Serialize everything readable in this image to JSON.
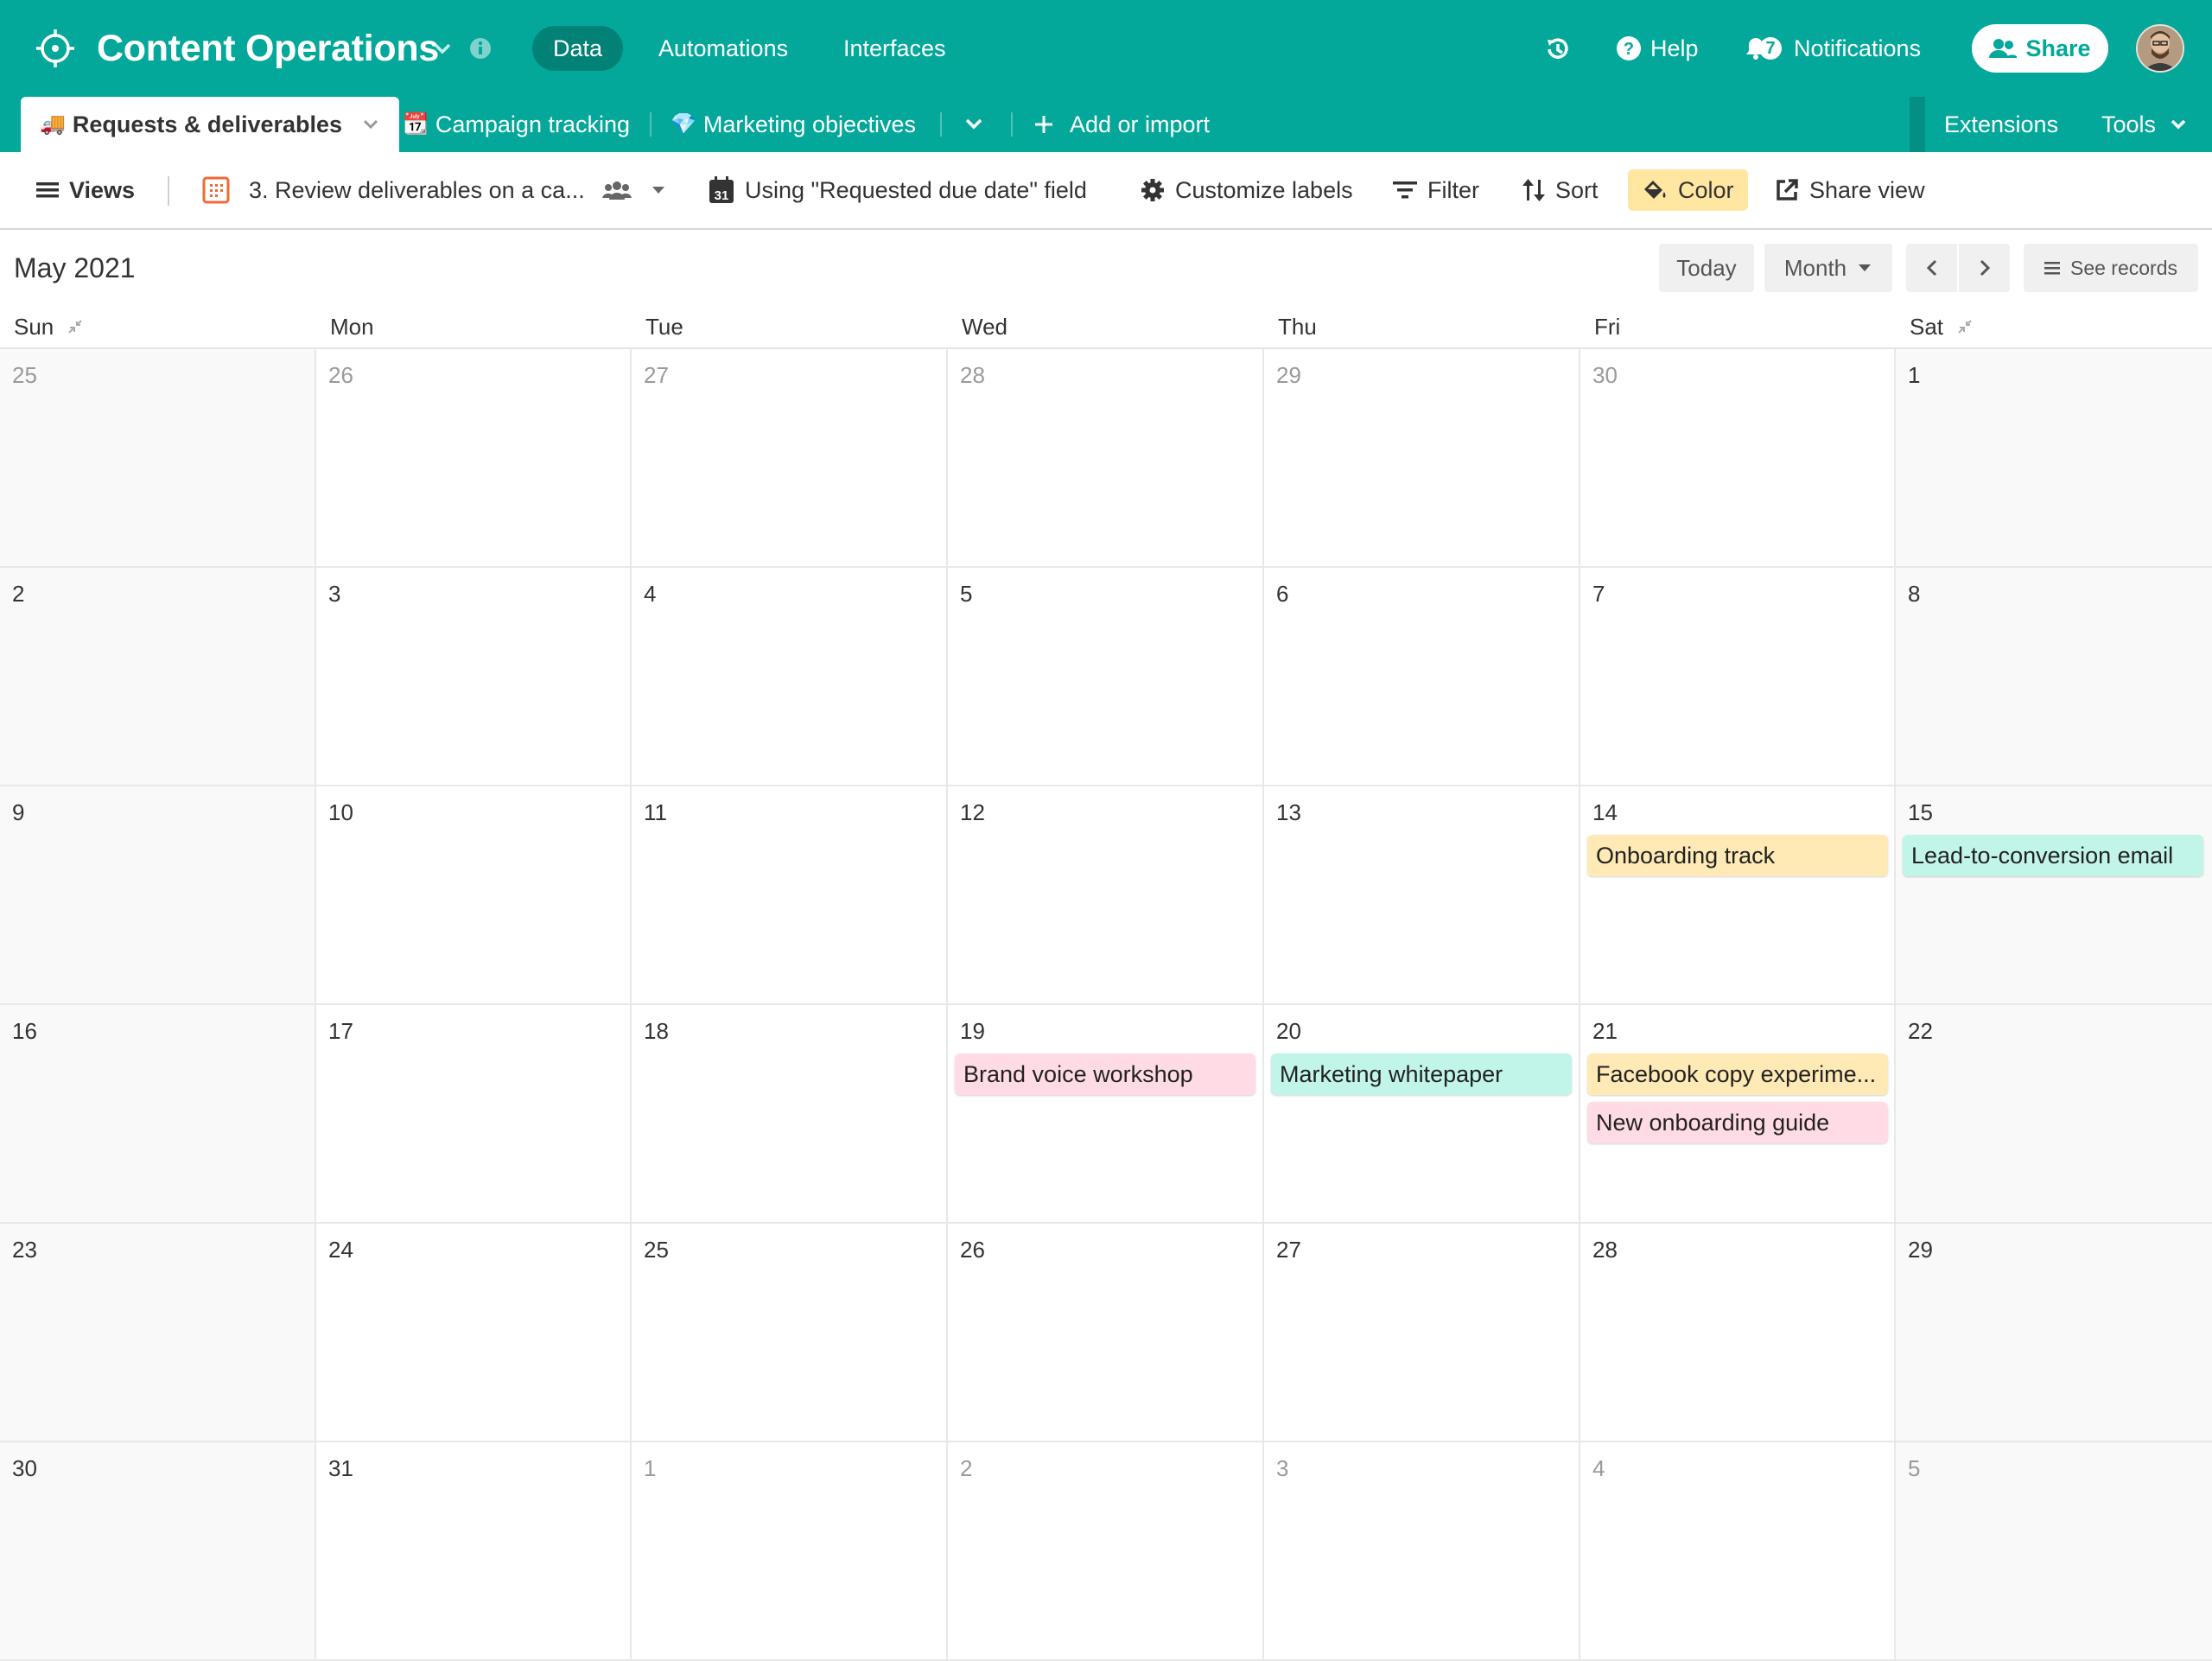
{
  "app": {
    "title": "Content Operations",
    "nav": [
      "Data",
      "Automations",
      "Interfaces"
    ],
    "help_label": "Help",
    "notifications_label": "Notifications",
    "notifications_count": "7",
    "share_label": "Share",
    "colors": {
      "brand": "#03a89a",
      "brand_dark": "#028277"
    }
  },
  "tabs": {
    "items": [
      {
        "icon": "truck-emoji",
        "label": "Requests & deliverables",
        "active": true
      },
      {
        "icon": "calendar-emoji",
        "label": "Campaign tracking",
        "active": false
      },
      {
        "icon": "gem-emoji",
        "label": "Marketing objectives",
        "active": false
      }
    ],
    "add_label": "Add or import",
    "extensions_label": "Extensions",
    "tools_label": "Tools"
  },
  "toolbar": {
    "views_label": "Views",
    "view_name": "3. Review deliverables on a ca...",
    "date_field_label": "Using \"Requested due date\" field",
    "customize_label": "Customize labels",
    "filter_label": "Filter",
    "sort_label": "Sort",
    "color_label": "Color",
    "share_view_label": "Share view"
  },
  "calendar": {
    "month_label": "May 2021",
    "today_label": "Today",
    "range_label": "Month",
    "see_records_label": "See records",
    "weekdays": [
      "Sun",
      "Mon",
      "Tue",
      "Wed",
      "Thu",
      "Fri",
      "Sat"
    ],
    "weeks": [
      [
        {
          "day": "25",
          "muted": true
        },
        {
          "day": "26",
          "muted": true
        },
        {
          "day": "27",
          "muted": true
        },
        {
          "day": "28",
          "muted": true
        },
        {
          "day": "29",
          "muted": true
        },
        {
          "day": "30",
          "muted": true
        },
        {
          "day": "1"
        }
      ],
      [
        {
          "day": "2"
        },
        {
          "day": "3"
        },
        {
          "day": "4"
        },
        {
          "day": "5"
        },
        {
          "day": "6"
        },
        {
          "day": "7"
        },
        {
          "day": "8"
        }
      ],
      [
        {
          "day": "9"
        },
        {
          "day": "10"
        },
        {
          "day": "11"
        },
        {
          "day": "12"
        },
        {
          "day": "13"
        },
        {
          "day": "14",
          "events": [
            {
              "title": "Onboarding track",
              "color": "#ffeab6"
            }
          ]
        },
        {
          "day": "15",
          "events": [
            {
              "title": "Lead-to-conversion email",
              "color": "#c2f5e9"
            }
          ]
        }
      ],
      [
        {
          "day": "16"
        },
        {
          "day": "17"
        },
        {
          "day": "18"
        },
        {
          "day": "19",
          "events": [
            {
              "title": "Brand voice workshop",
              "color": "#ffdce5"
            }
          ]
        },
        {
          "day": "20",
          "events": [
            {
              "title": "Marketing whitepaper",
              "color": "#c2f5e9"
            }
          ]
        },
        {
          "day": "21",
          "events": [
            {
              "title": "Facebook copy experime...",
              "color": "#ffeab6"
            },
            {
              "title": "New onboarding guide",
              "color": "#ffdce5"
            }
          ]
        },
        {
          "day": "22"
        }
      ],
      [
        {
          "day": "23"
        },
        {
          "day": "24"
        },
        {
          "day": "25"
        },
        {
          "day": "26"
        },
        {
          "day": "27"
        },
        {
          "day": "28"
        },
        {
          "day": "29"
        }
      ],
      [
        {
          "day": "30"
        },
        {
          "day": "31"
        },
        {
          "day": "1",
          "muted": true
        },
        {
          "day": "2",
          "muted": true
        },
        {
          "day": "3",
          "muted": true
        },
        {
          "day": "4",
          "muted": true
        },
        {
          "day": "5",
          "muted": true
        }
      ]
    ]
  }
}
